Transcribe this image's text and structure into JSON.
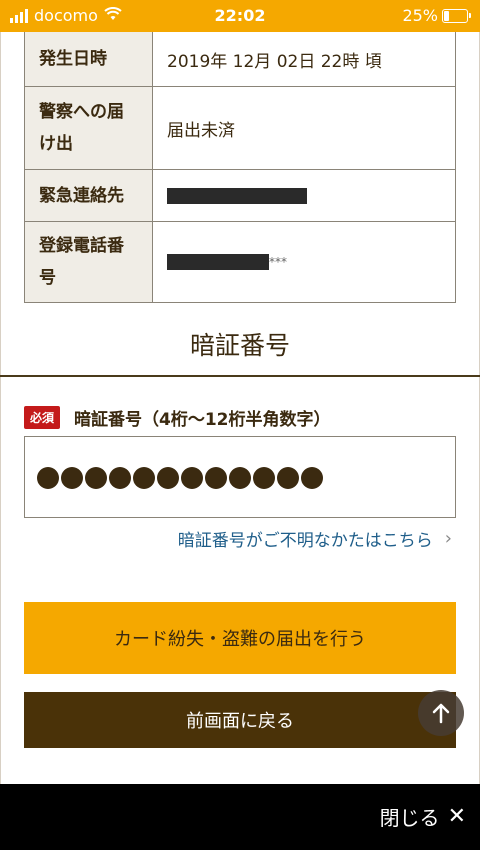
{
  "status_bar": {
    "carrier": "docomo",
    "time": "22:02",
    "battery": "25%",
    "battery_level": 0.25
  },
  "info_table": {
    "rows": [
      {
        "label_line1": "発生日時",
        "label_line2": "",
        "value": "2019年 12月 02日 22時 頃"
      },
      {
        "label_line1": "警察への届",
        "label_line2": "け出",
        "value": "届出未済"
      },
      {
        "label_line1": "緊急連絡先",
        "label_line2": "",
        "value": ""
      },
      {
        "label_line1": "登録電話番",
        "label_line2": "号",
        "value": "***"
      }
    ]
  },
  "pin_section": {
    "title": "暗証番号",
    "required": "必須",
    "label": "暗証番号（4桁〜12桁半角数字）",
    "dot_count": 12,
    "help_link": "暗証番号がご不明なかたはこちら"
  },
  "buttons": {
    "submit": "カード紛失・盗難の届出を行う",
    "back": "前画面に戻る"
  },
  "bottom_bar": {
    "close": "閉じる"
  },
  "icons": {
    "signal": "signal-icon",
    "wifi": "wifi-icon",
    "battery": "battery-icon",
    "chevron": "chevron-right-icon",
    "scroll_top": "arrow-up-icon",
    "close": "close-icon"
  },
  "colors": {
    "accent": "#f5a800",
    "dark_brown": "#4a3208",
    "required_red": "#c41a1a",
    "link_blue": "#1f5e8a"
  }
}
